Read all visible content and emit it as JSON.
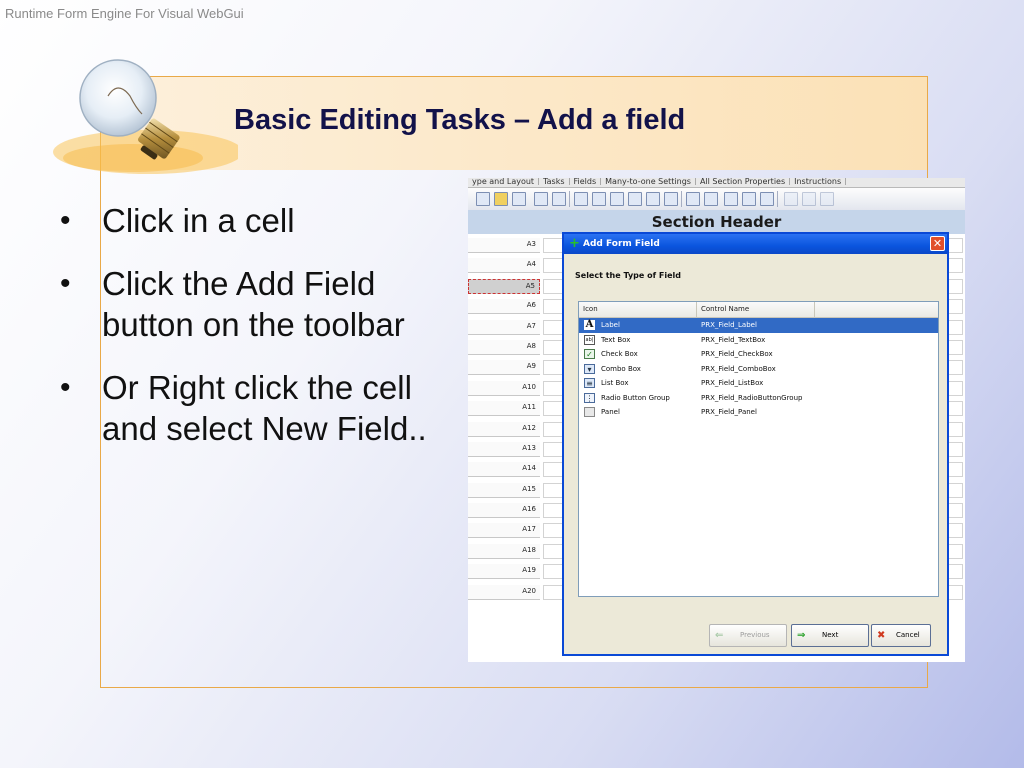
{
  "header": {
    "text": "Runtime Form Engine For Visual WebGui"
  },
  "slide": {
    "title": "Basic Editing Tasks – Add a field",
    "bullets": [
      "Click in a cell",
      "Click the Add Field button on the toolbar",
      "Or Right click the cell and select New Field.."
    ]
  },
  "app": {
    "tabs": [
      "ype and Layout",
      "Tasks",
      "Fields",
      "Many-to-one Settings",
      "All Section Properties",
      "Instructions"
    ],
    "section_header": "Section Header",
    "rows": [
      "A3",
      "A4",
      "A5",
      "A6",
      "A7",
      "A8",
      "A9",
      "A10",
      "A11",
      "A12",
      "A13",
      "A14",
      "A15",
      "A16",
      "A17",
      "A18",
      "A19",
      "A20"
    ],
    "selected_row": "A5"
  },
  "dialog": {
    "title": "Add Form Field",
    "subtitle": "Select the Type of Field",
    "columns": {
      "icon": "Icon",
      "control": "Control Name"
    },
    "items": [
      {
        "name": "Label",
        "control": "PRX_Field_Label",
        "icon": "label-icon",
        "glyph": "A",
        "selected": true
      },
      {
        "name": "Text Box",
        "control": "PRX_Field_TextBox",
        "icon": "textbox-icon",
        "glyph": "ab|"
      },
      {
        "name": "Check Box",
        "control": "PRX_Field_CheckBox",
        "icon": "checkbox-icon",
        "glyph": "✓"
      },
      {
        "name": "Combo Box",
        "control": "PRX_Field_ComboBox",
        "icon": "combobox-icon",
        "glyph": "▾"
      },
      {
        "name": "List Box",
        "control": "PRX_Field_ListBox",
        "icon": "listbox-icon",
        "glyph": "≡"
      },
      {
        "name": "Radio Button Group",
        "control": "PRX_Field_RadioButtonGroup",
        "icon": "radio-group-icon",
        "glyph": "⋮"
      },
      {
        "name": "Panel",
        "control": "PRX_Field_Panel",
        "icon": "panel-icon",
        "glyph": ""
      }
    ],
    "buttons": {
      "previous": "Previous",
      "next": "Next",
      "cancel": "Cancel"
    }
  },
  "colors": {
    "accent": "#e9a948",
    "title": "#12124a",
    "selection": "#316ac5",
    "dialog_title": "#0a55de"
  }
}
